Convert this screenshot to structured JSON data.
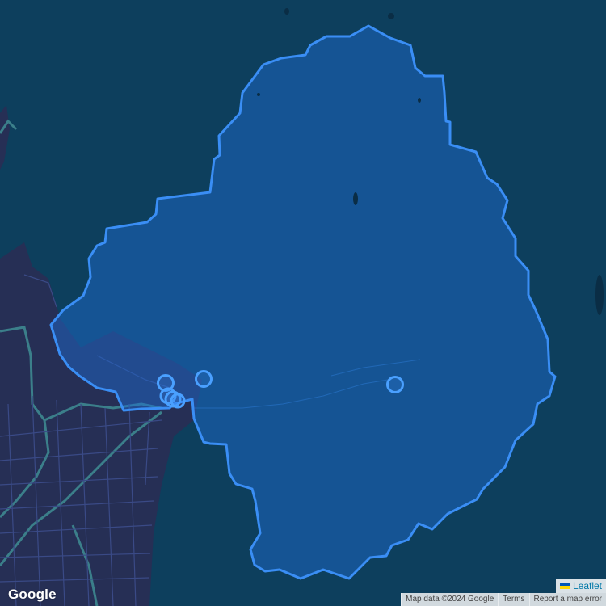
{
  "map": {
    "provider_logo": "Google",
    "theme_colors": {
      "water": "#0d3f5d",
      "land_dark": "#262f55",
      "road_major": "#3b7f8a",
      "road_minor": "#3a4a86",
      "region_fill": "#1f6fd6",
      "region_stroke": "#3a8ef5",
      "marker": "#4aa0ff"
    },
    "markers": [
      {
        "name": "marker-1"
      },
      {
        "name": "marker-2"
      },
      {
        "name": "marker-3"
      },
      {
        "name": "marker-cluster"
      }
    ]
  },
  "attribution": {
    "leaflet_label": "Leaflet",
    "map_data": "Map data ©2024 Google",
    "terms": "Terms",
    "report": "Report a map error"
  }
}
